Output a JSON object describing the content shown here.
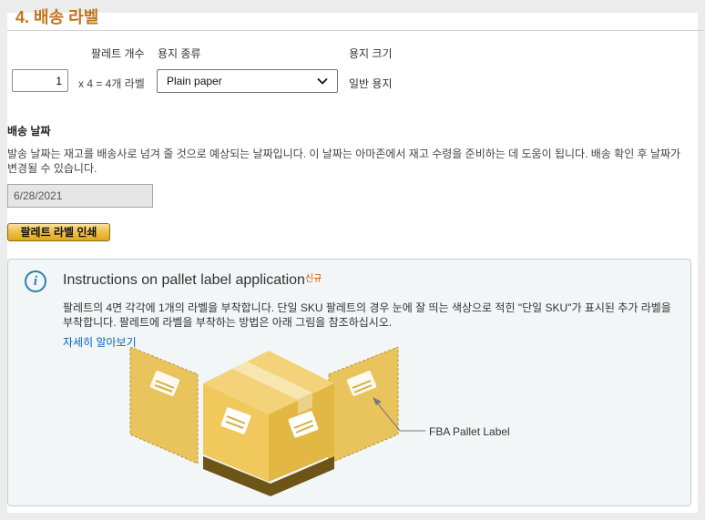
{
  "section_title": "4. 배송 라벨",
  "columns": {
    "pallet_count": "팔레트 개수",
    "paper_type": "용지 종류",
    "paper_size": "용지 크기"
  },
  "quantity": {
    "value": "1",
    "calc_text": "x 4 = 4개 라벨"
  },
  "paper_type_select": {
    "selected": "Plain paper"
  },
  "paper_size_value": "일반 용지",
  "ship_date": {
    "heading": "배송 날짜",
    "description": "발송 날짜는 재고를 배송사로 넘겨 줄 것으로 예상되는 날짜입니다. 이 날짜는 아마존에서 재고 수령을 준비하는 데 도움이 됩니다. 배송 확인 후 날짜가 변경될 수 있습니다.",
    "value": "6/28/2021"
  },
  "print_button": "팔레트 라벨 인쇄",
  "info": {
    "title": "Instructions on pallet label application",
    "new_badge": "신규",
    "body": "팔레트의 4면 각각에 1개의 라벨을 부착합니다. 단일 SKU 팔레트의 경우 눈에 잘 띄는 색상으로 적힌 \"단일 SKU\"가 표시된 추가 라벨을 부착합니다. 팔레트에 라벨을 부착하는 방법은 아래 그림을 참조하십시오.",
    "link": "자세히 알아보기",
    "diagram_label": "FBA Pallet Label"
  },
  "icons": [
    "info-icon",
    "chevron-down-icon"
  ],
  "colors": {
    "title": "#c0751a",
    "link": "#0066c0",
    "button": "#f0c14b",
    "box": "#e8c35a"
  }
}
